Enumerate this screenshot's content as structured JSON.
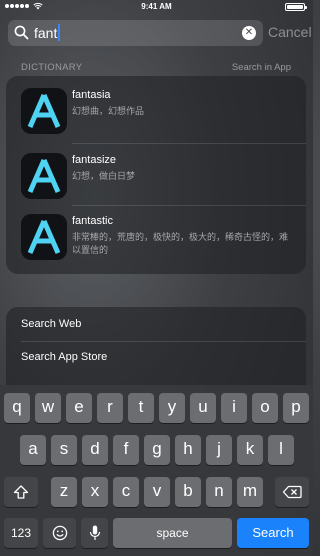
{
  "status_bar": {
    "time": "9:41 AM"
  },
  "search": {
    "query": "fant",
    "cancel_label": "Cancel"
  },
  "dictionary": {
    "section_label": "DICTIONARY",
    "search_in_app_label": "Search in App",
    "entries": [
      {
        "word": "fantasia",
        "definition": "幻想曲，幻想作品"
      },
      {
        "word": "fantasize",
        "definition": "幻想，做白日梦"
      },
      {
        "word": "fantastic",
        "definition": "非常棒的，荒唐的，极快的，极大的，稀奇古怪的，难以置信的"
      }
    ]
  },
  "web_search": {
    "items": [
      "Search Web",
      "Search App Store"
    ]
  },
  "keyboard": {
    "row1": [
      "q",
      "w",
      "e",
      "r",
      "t",
      "y",
      "u",
      "i",
      "o",
      "p"
    ],
    "row2": [
      "a",
      "s",
      "d",
      "f",
      "g",
      "h",
      "j",
      "k",
      "l"
    ],
    "row3": [
      "z",
      "x",
      "c",
      "v",
      "b",
      "n",
      "m"
    ],
    "numbers_label": "123",
    "space_label": "space",
    "search_label": "Search"
  },
  "colors": {
    "accent": "#1a82fb",
    "caret": "#3a85ff",
    "app_icon_letter": "#4fd3f2"
  },
  "icons": [
    "search-icon",
    "clear-icon",
    "wifi-icon",
    "battery-icon",
    "shift-icon",
    "delete-icon",
    "emoji-icon",
    "microphone-icon"
  ]
}
